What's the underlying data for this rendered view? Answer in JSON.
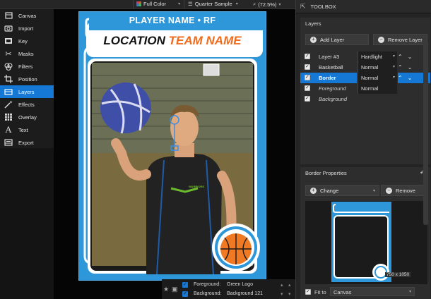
{
  "topbar": {
    "color_mode": "Full Color",
    "sample_mode": "Quarter Sample",
    "zoom": "(72.5%)"
  },
  "leftnav": {
    "items": [
      {
        "label": "Canvas",
        "icon": "canvas-icon",
        "active": false
      },
      {
        "label": "Import",
        "icon": "camera-icon",
        "active": false
      },
      {
        "label": "Key",
        "icon": "key-icon",
        "active": false
      },
      {
        "label": "Masks",
        "icon": "scissors-icon",
        "active": false
      },
      {
        "label": "Filters",
        "icon": "filters-icon",
        "active": false
      },
      {
        "label": "Position",
        "icon": "crop-icon",
        "active": false
      },
      {
        "label": "Layers",
        "icon": "layers-icon",
        "active": true
      },
      {
        "label": "Effects",
        "icon": "wand-icon",
        "active": false
      },
      {
        "label": "Overlay",
        "icon": "grid-icon",
        "active": false
      },
      {
        "label": "Text",
        "icon": "text-icon",
        "active": false
      },
      {
        "label": "Export",
        "icon": "export-icon",
        "active": false
      }
    ]
  },
  "card": {
    "player_line": "PLAYER NAME • RF",
    "location": "LOCATION",
    "team": "TEAM NAME",
    "jersey_text": "WARRIORS",
    "colors": {
      "blue": "#2e97da",
      "orange": "#f26a1b",
      "black": "#111111"
    }
  },
  "canvas_footer": {
    "foreground_label": "Foreground:",
    "foreground_value": "Green Logo",
    "background_label": "Background:",
    "background_value": "Background 121"
  },
  "toolbox": {
    "title": "TOOLBOX",
    "layers_title": "Layers",
    "add_layer": "Add Layer",
    "remove_layer": "Remove Layer",
    "layers": [
      {
        "name": "Layer #3",
        "blend": "Hardlight",
        "selected": false,
        "italic": false
      },
      {
        "name": "Basketball",
        "blend": "Normal",
        "selected": false,
        "italic": false
      },
      {
        "name": "Border",
        "blend": "Normal",
        "selected": true,
        "italic": false
      },
      {
        "name": "Foreground",
        "blend": "Normal",
        "selected": false,
        "italic": true
      },
      {
        "name": "Background",
        "blend": "",
        "selected": false,
        "italic": true
      }
    ],
    "border_title": "Border Properties",
    "change": "Change",
    "remove": "Remove",
    "preview_size": "750 x 1050",
    "fit_to_label": "Fit to",
    "fit_to_value": "Canvas"
  }
}
